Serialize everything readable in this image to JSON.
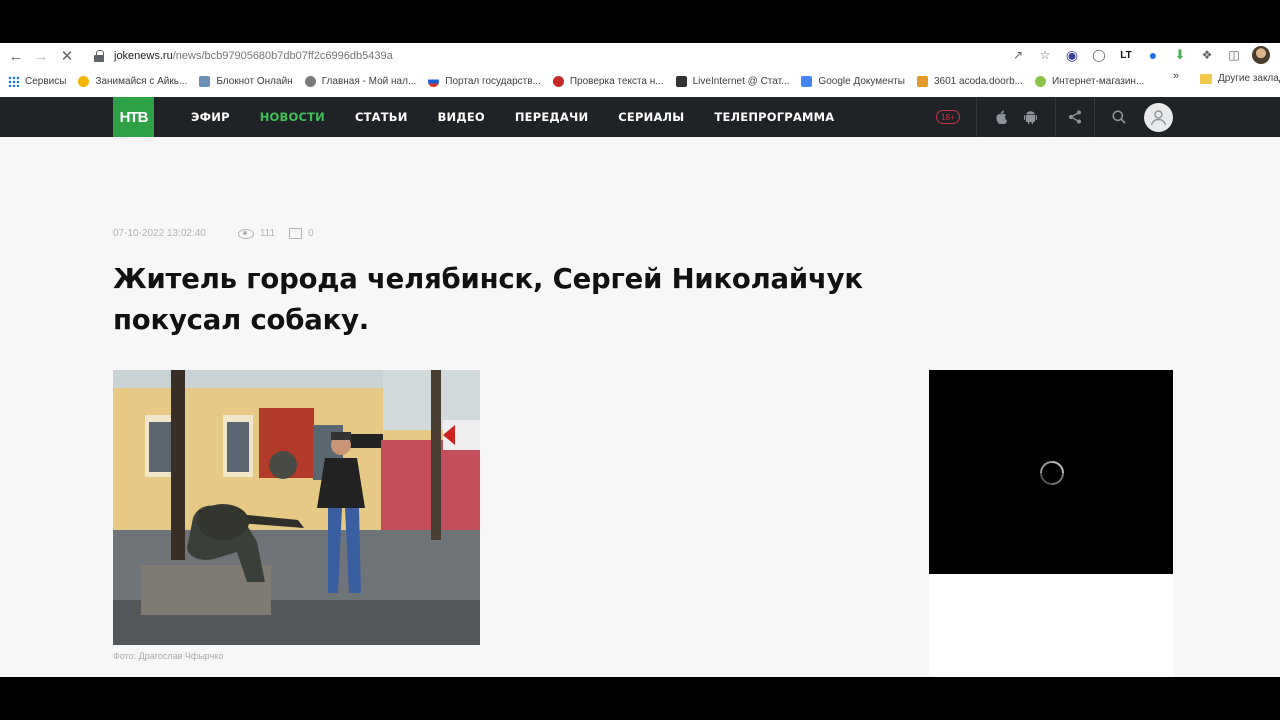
{
  "browser": {
    "url_host": "jokenews.ru",
    "url_path": "/news/bcb97905680b7db07ff2c6996db5439a",
    "bookmarks": [
      {
        "label": "Сервисы",
        "color": "#1a73e8"
      },
      {
        "label": "Занимайся с Айкь...",
        "color": "#f4b400"
      },
      {
        "label": "Блокнот Онлайн",
        "color": "#6d8fb8"
      },
      {
        "label": "Главная - Мой нал...",
        "color": "#7a7a7a"
      },
      {
        "label": "Портал государств...",
        "color": "#d93025"
      },
      {
        "label": "Проверка текста н...",
        "color": "#c62828"
      },
      {
        "label": "LiveInternet @ Стат...",
        "color": "#333333"
      },
      {
        "label": "Google Документы",
        "color": "#4285f4"
      },
      {
        "label": "3601 acoda.doorb...",
        "color": "#e39a28"
      },
      {
        "label": "Интернет-магазин...",
        "color": "#8bc34a"
      }
    ],
    "bookmarks_more": "»",
    "other_bookmarks": "Другие заклад"
  },
  "site": {
    "logo": "НТВ",
    "menu": [
      {
        "label": "ЭФИР",
        "active": false
      },
      {
        "label": "НОВОСТИ",
        "active": true
      },
      {
        "label": "СТАТЬИ",
        "active": false
      },
      {
        "label": "ВИДЕО",
        "active": false
      },
      {
        "label": "ПЕРЕДАЧИ",
        "active": false
      },
      {
        "label": "СЕРИАЛЫ",
        "active": false
      },
      {
        "label": "ТЕЛЕПРОГРАММА",
        "active": false
      }
    ],
    "age_badge": "18+",
    "accent_color": "#2ea146",
    "active_menu_color": "#3fbf57"
  },
  "article": {
    "date": "07-10-2022 13:02:40",
    "views": "111",
    "comments": "0",
    "title": "Житель города челябинск, Сергей Николайчук покусал собаку.",
    "photo_caption": "Фото: Драгослав Чфырчко"
  }
}
